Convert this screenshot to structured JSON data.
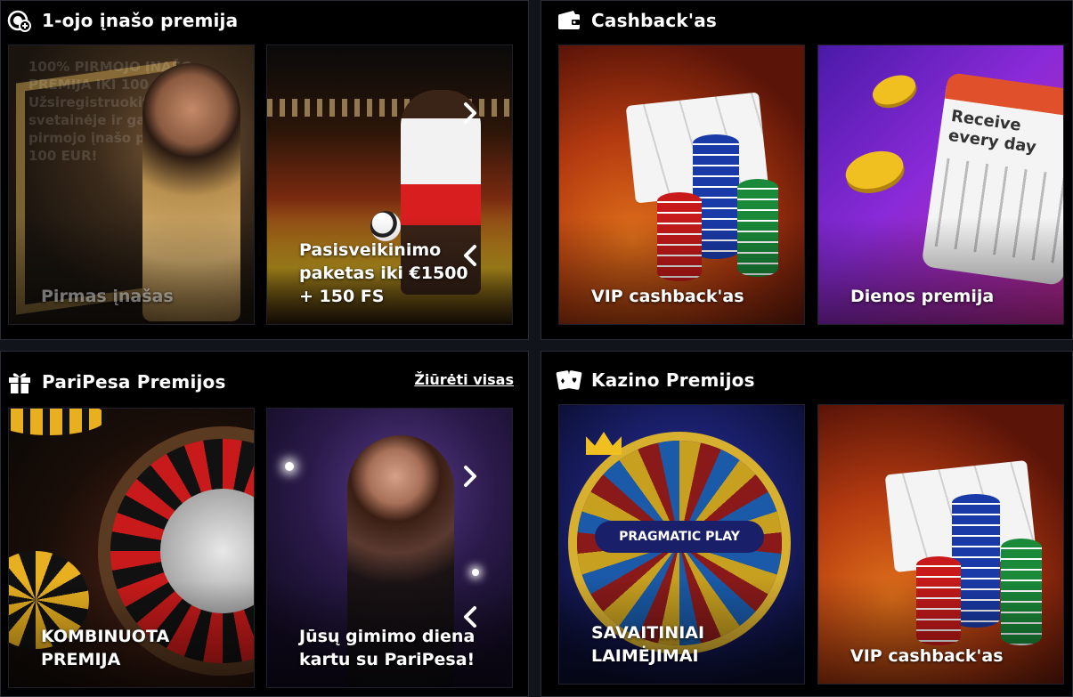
{
  "panels": {
    "first_deposit": {
      "title": "1-ojo įnašo premija",
      "icon": "coin-deposit-icon",
      "cards": [
        {
          "label": "Pirmas įnašas",
          "overlay_text": "100% PIRMOJO ĮNAŠO PREMIJA IKI 100 EUR Užsiregistruokite ParіPesa svetainėje ir gaukite 100% pirmojo įnašo premiją iki 100 EUR!"
        },
        {
          "label": "Pasisveikinimo paketas iki €1500 + 150 FS"
        }
      ]
    },
    "cashback": {
      "title": "Cashback'as",
      "icon": "wallet-icon",
      "cards": [
        {
          "label": "VIP cashback'as"
        },
        {
          "label": "Dienos premija",
          "calendar_text": "Receive every day"
        }
      ]
    },
    "paripesa_bonuses": {
      "title": "PariPesa Premijos",
      "icon": "gift-icon",
      "see_all": "Žiūrėti visas",
      "cards": [
        {
          "label": "KOMBINUOTA PREMIJA"
        },
        {
          "label": "Jūsų gimimo diena kartu su PariPesa!"
        }
      ]
    },
    "casino_bonuses": {
      "title": "Kazino Premijos",
      "icon": "cards-icon",
      "cards": [
        {
          "label": "SAVAITINIAI LAIMĖJIMAI",
          "logo_text": "PRAGMATIC PLAY"
        },
        {
          "label": "VIP cashback'as"
        }
      ]
    }
  },
  "colors": {
    "background": "#12141c",
    "panel": "#000000",
    "border": "#2a2d38"
  }
}
